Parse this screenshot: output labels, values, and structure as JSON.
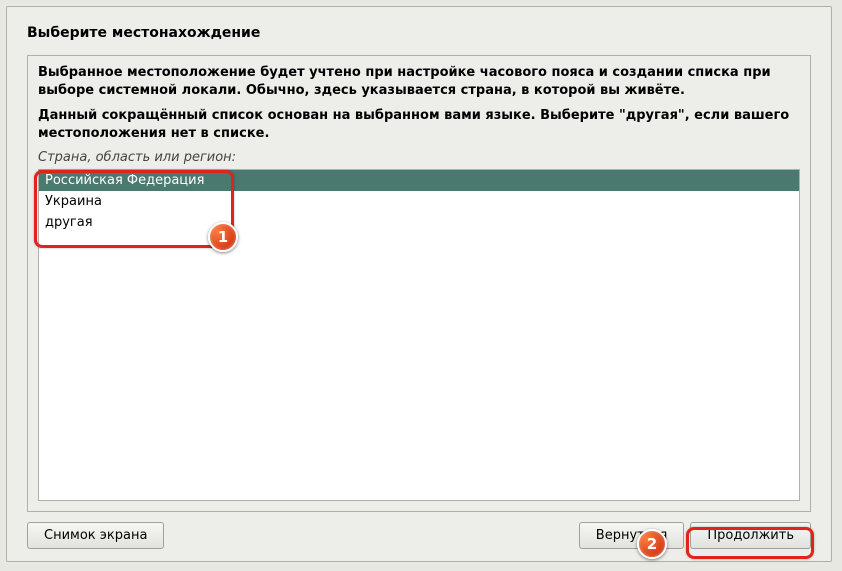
{
  "title": "Выберите местонахождение",
  "description1": "Выбранное местоположение будет учтено при настройке часового пояса и создании списка при выборе системной локали. Обычно, здесь указывается страна, в которой вы живёте.",
  "description2": "Данный сокращённый список основан на выбранном вами языке. Выберите \"другая\", если вашего местоположения нет в списке.",
  "list_label": "Страна, область или регион:",
  "items": [
    {
      "label": "Российская Федерация",
      "selected": true
    },
    {
      "label": "Украина",
      "selected": false
    },
    {
      "label": "другая",
      "selected": false
    }
  ],
  "buttons": {
    "screenshot": "Снимок экрана",
    "back": "Вернуться",
    "continue": "Продолжить"
  },
  "annotations": {
    "badge1": "1",
    "badge2": "2"
  }
}
